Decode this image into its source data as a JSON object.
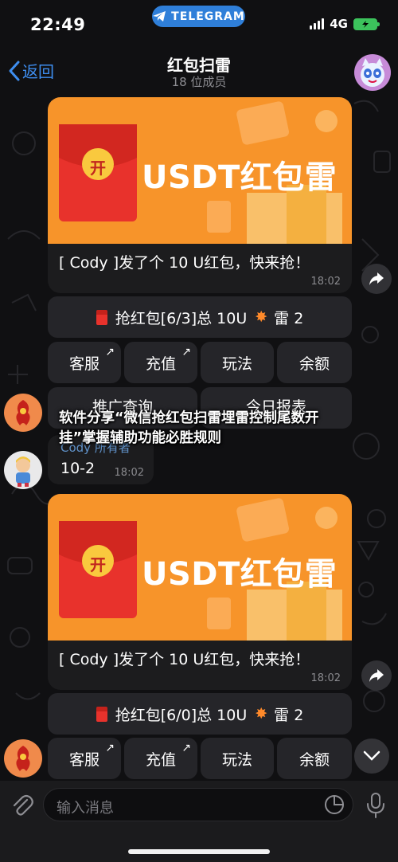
{
  "status_bar": {
    "time": "22:49",
    "app_pill": "TELEGRAM",
    "network": "4G"
  },
  "header": {
    "back_label": "返回",
    "title": "红包扫雷",
    "subtitle": "18 位成员"
  },
  "messages": [
    {
      "banner_title": "USDT红包雷",
      "coin_glyph": "开",
      "text": "[ Cody ]发了个 10 U红包，快来抢！",
      "time": "18:02",
      "grab_button": "抢红包[6/3]总 10U",
      "mine_label": "雷 2",
      "buttons": [
        "客服",
        "充值",
        "玩法",
        "余额"
      ],
      "buttons_row3": [
        "推广查询",
        "今日报表"
      ]
    },
    {
      "banner_title": "USDT红包雷",
      "coin_glyph": "开",
      "text": "[ Cody ]发了个 10 U红包，快来抢！",
      "time": "18:02",
      "grab_button": "抢红包[6/0]总 10U",
      "mine_label": "雷 2",
      "buttons": [
        "客服",
        "充值",
        "玩法",
        "余额"
      ]
    }
  ],
  "reply": {
    "name": "Cody 所有者",
    "text": "10-2",
    "time": "18:02"
  },
  "overlay_caption": "软件分享“微信抢红包扫雷埋雷控制尾数开挂”掌握辅助功能必胜规则",
  "composer": {
    "placeholder": "输入消息"
  },
  "colors": {
    "accent": "#3e8ef0",
    "banner": "#f7942a",
    "envelope": "#e8322c",
    "battery": "#3cc35c"
  }
}
